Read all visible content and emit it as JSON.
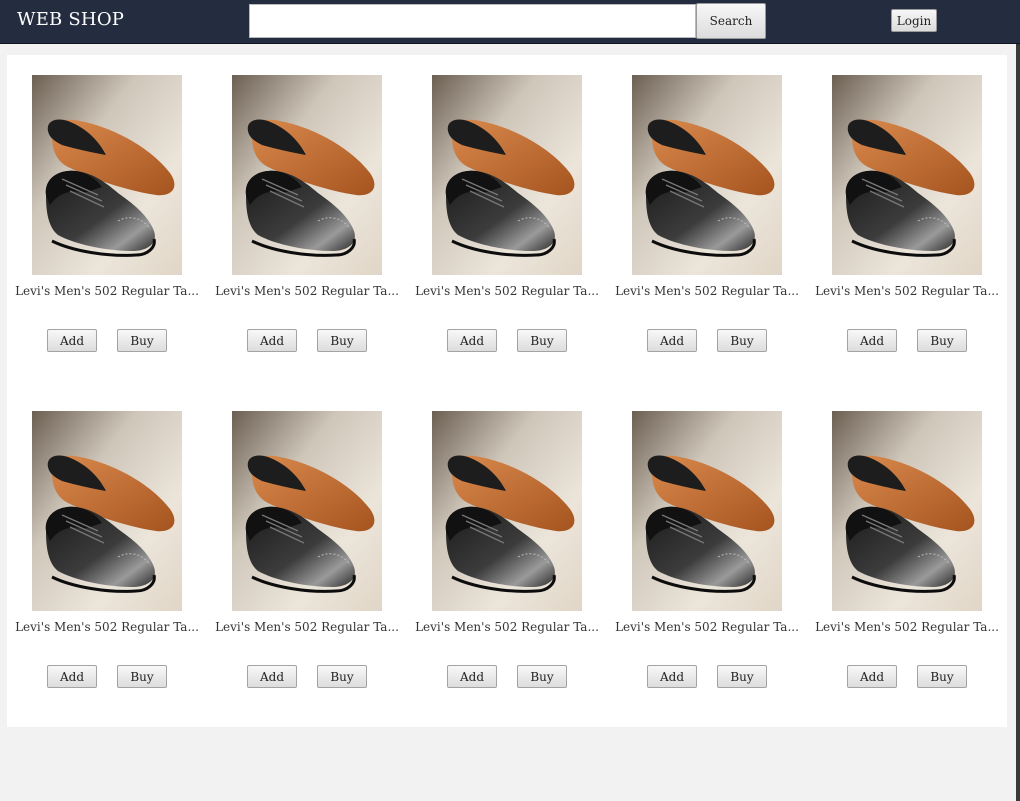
{
  "header": {
    "brand": "WEB SHOP",
    "search_value": "",
    "search_placeholder": "",
    "search_button": "Search",
    "login_button": "Login",
    "background_color": "#232d3f"
  },
  "products": [
    {
      "title": "Levi's Men's 502 Regular Ta...",
      "image": "black-oxford-shoe-image",
      "add_label": "Add",
      "buy_label": "Buy"
    },
    {
      "title": "Levi's Men's 502 Regular Ta...",
      "image": "black-oxford-shoe-image",
      "add_label": "Add",
      "buy_label": "Buy"
    },
    {
      "title": "Levi's Men's 502 Regular Ta...",
      "image": "black-oxford-shoe-image",
      "add_label": "Add",
      "buy_label": "Buy"
    },
    {
      "title": "Levi's Men's 502 Regular Ta...",
      "image": "black-oxford-shoe-image",
      "add_label": "Add",
      "buy_label": "Buy"
    },
    {
      "title": "Levi's Men's 502 Regular Ta...",
      "image": "black-oxford-shoe-image",
      "add_label": "Add",
      "buy_label": "Buy"
    },
    {
      "title": "Levi's Men's 502 Regular Ta...",
      "image": "black-oxford-shoe-image",
      "add_label": "Add",
      "buy_label": "Buy"
    },
    {
      "title": "Levi's Men's 502 Regular Ta...",
      "image": "black-oxford-shoe-image",
      "add_label": "Add",
      "buy_label": "Buy"
    },
    {
      "title": "Levi's Men's 502 Regular Ta...",
      "image": "black-oxford-shoe-image",
      "add_label": "Add",
      "buy_label": "Buy"
    },
    {
      "title": "Levi's Men's 502 Regular Ta...",
      "image": "black-oxford-shoe-image",
      "add_label": "Add",
      "buy_label": "Buy"
    },
    {
      "title": "Levi's Men's 502 Regular Ta...",
      "image": "black-oxford-shoe-image",
      "add_label": "Add",
      "buy_label": "Buy"
    }
  ]
}
